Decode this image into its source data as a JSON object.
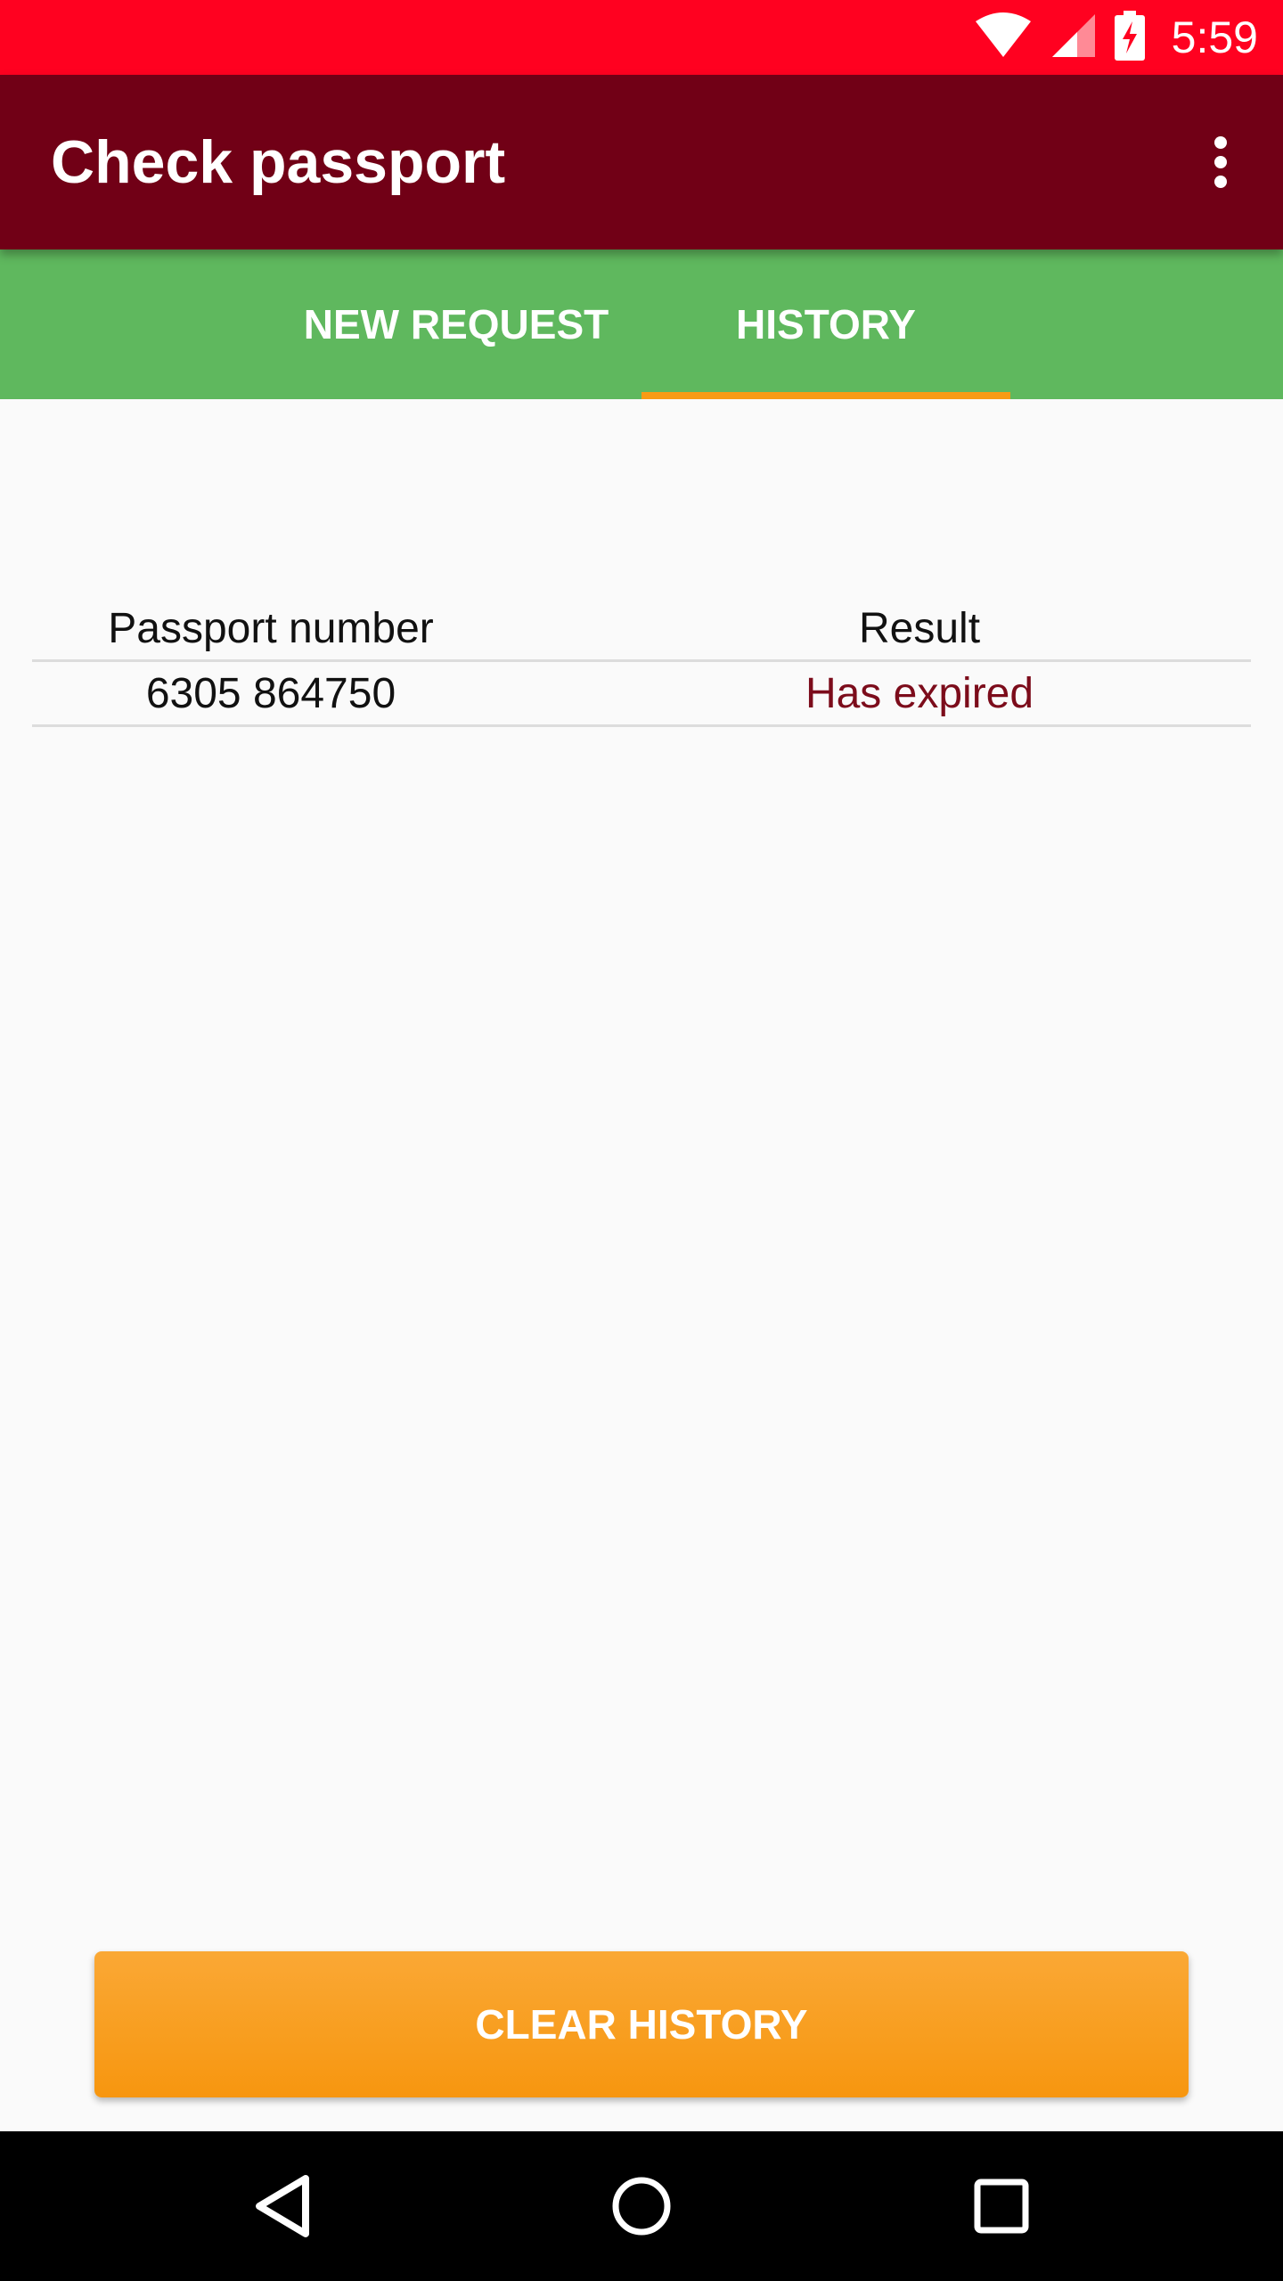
{
  "status_bar": {
    "time": "5:59",
    "icons": [
      "wifi-icon",
      "cell-signal-icon",
      "battery-charging-icon"
    ],
    "background": "#ff0120"
  },
  "app_bar": {
    "title": "Check passport",
    "background": "#710016",
    "menu_icon": "more-vert-icon"
  },
  "tabs": [
    {
      "label": "NEW REQUEST",
      "selected": false
    },
    {
      "label": "HISTORY",
      "selected": true
    }
  ],
  "tab_bar": {
    "background": "#5fb85e",
    "indicator_color": "#f89b14"
  },
  "history_table": {
    "headers": [
      "Passport number",
      "Result"
    ],
    "rows": [
      {
        "passport_number": "6305 864750",
        "result": "Has expired"
      }
    ]
  },
  "clear_button": {
    "label": "CLEAR HISTORY",
    "color": "#f89b14"
  },
  "nav_bar": {
    "icons": [
      "back-icon",
      "home-icon",
      "recent-apps-icon"
    ]
  }
}
